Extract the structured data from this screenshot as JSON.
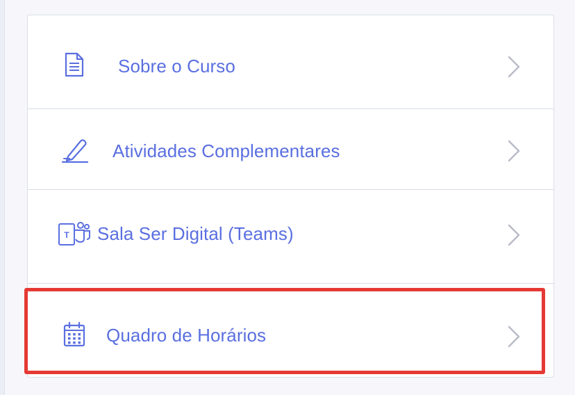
{
  "menu": {
    "items": [
      {
        "label": "Sobre o Curso",
        "icon": "document-icon"
      },
      {
        "label": "Atividades Complementares",
        "icon": "pencil-icon"
      },
      {
        "label": "Sala Ser Digital (Teams)",
        "icon": "teams-icon"
      },
      {
        "label": "Quadro de Horários",
        "icon": "calendar-icon"
      }
    ]
  },
  "colors": {
    "accent": "#5a6fe0",
    "chevron": "#b9bcc8",
    "highlight": "#e53935"
  }
}
